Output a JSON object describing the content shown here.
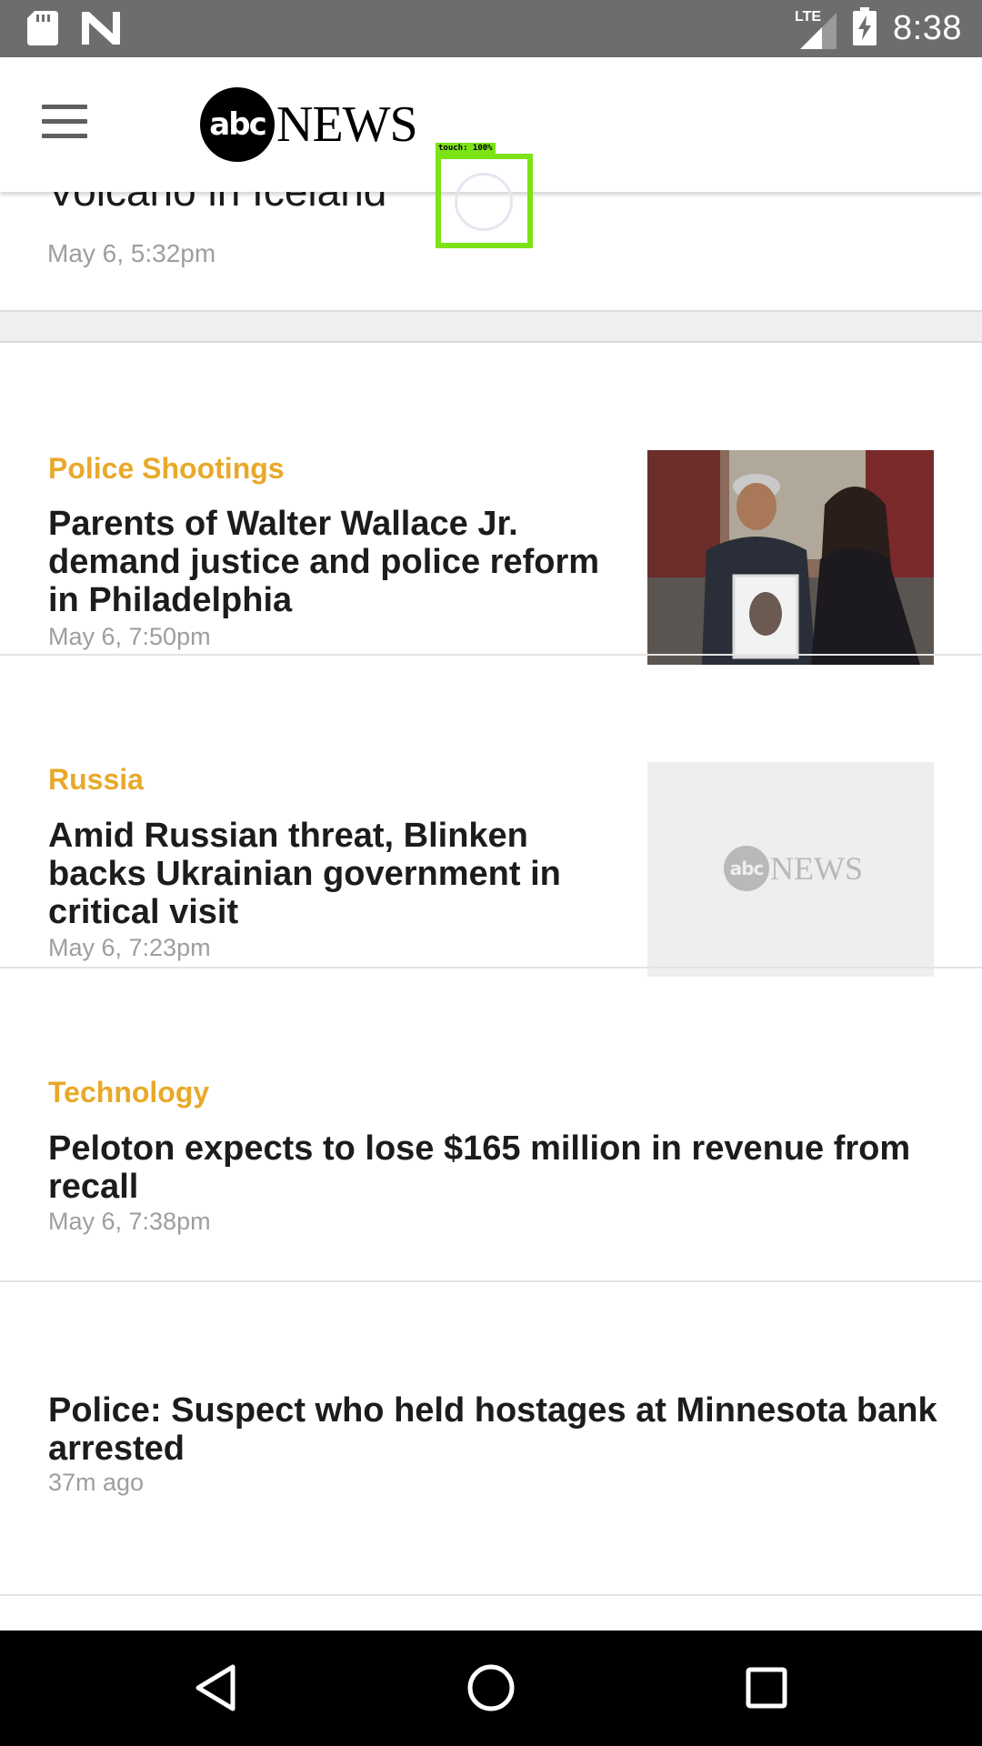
{
  "status_bar": {
    "network_label": "LTE",
    "time": "8:38",
    "icons": [
      "sd-card-icon",
      "n-logo-icon",
      "signal-icon",
      "battery-charging-icon"
    ]
  },
  "header": {
    "menu_icon": "hamburger-menu-icon",
    "logo_mark": "abc",
    "logo_word": "NEWS"
  },
  "feed": {
    "partial_story": {
      "title": "Volcano in Iceland",
      "date": "May 6, 5:32pm"
    },
    "stories": [
      {
        "category": "Police Shootings",
        "headline": "Parents of Walter Wallace Jr. demand justice and police reform in Philadelphia",
        "date": "May 6, 7:50pm",
        "thumbnail": "photo"
      },
      {
        "category": "Russia",
        "headline": "Amid Russian threat, Blinken backs Ukrainian government in critical visit",
        "date": "May 6, 7:23pm",
        "thumbnail": "placeholder",
        "placeholder_mark": "abc",
        "placeholder_word": "NEWS"
      },
      {
        "category": "Technology",
        "headline": "Peloton expects to lose $165 million in revenue from recall",
        "date": "May 6, 7:38pm"
      },
      {
        "category": "",
        "headline": "Police: Suspect who held hostages at Minnesota bank arrested",
        "date": "37m ago"
      }
    ]
  },
  "overlay": {
    "touch_label": "touch: 100%"
  },
  "nav_bar": {
    "icons": [
      "back-icon",
      "home-icon",
      "recents-icon"
    ]
  },
  "colors": {
    "category": "#e8a92a",
    "touch_box": "#7be316",
    "status_bar": "#6d6d6d"
  }
}
